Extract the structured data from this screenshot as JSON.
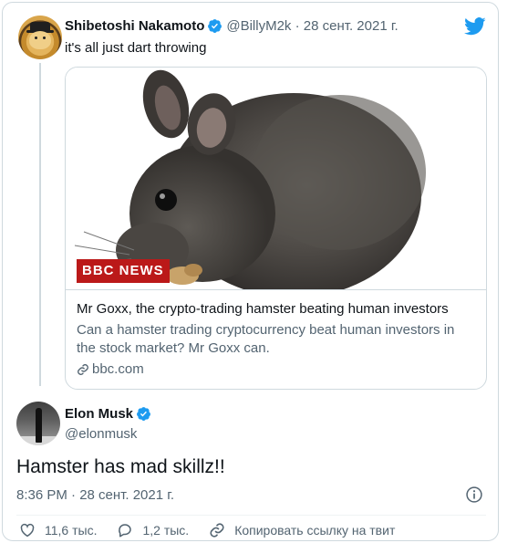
{
  "quoted_tweet": {
    "author_name": "Shibetoshi Nakamoto",
    "handle": "@BillyM2k",
    "separator": " · ",
    "date": "28 сент. 2021 г.",
    "text": "it's all just dart throwing",
    "link_card": {
      "image_badge": "BBC NEWS",
      "title": "Mr Goxx, the crypto-trading hamster beating human investors",
      "description": "Can a hamster trading cryptocurrency beat human investors in the stock market? Mr Goxx can.",
      "domain": "bbc.com"
    }
  },
  "main_tweet": {
    "author_name": "Elon Musk",
    "handle": "@elonmusk",
    "text": "Hamster has mad skillz!!",
    "timestamp": "8:36 PM · 28 сент. 2021 г."
  },
  "actions": {
    "likes": "11,6 тыс.",
    "replies": "1,2 тыс.",
    "copy_link": "Копировать ссылку на твит"
  },
  "colors": {
    "brand_blue": "#1d9bf0",
    "muted_text": "#536471",
    "border": "#cfd9de",
    "bbc_red": "#bb1919"
  },
  "icons": {
    "verified": "verified-badge-icon",
    "twitter": "twitter-bird-icon",
    "link": "link-icon",
    "info": "info-icon",
    "like": "heart-icon",
    "reply": "reply-bubble-icon",
    "copy": "link-icon"
  }
}
